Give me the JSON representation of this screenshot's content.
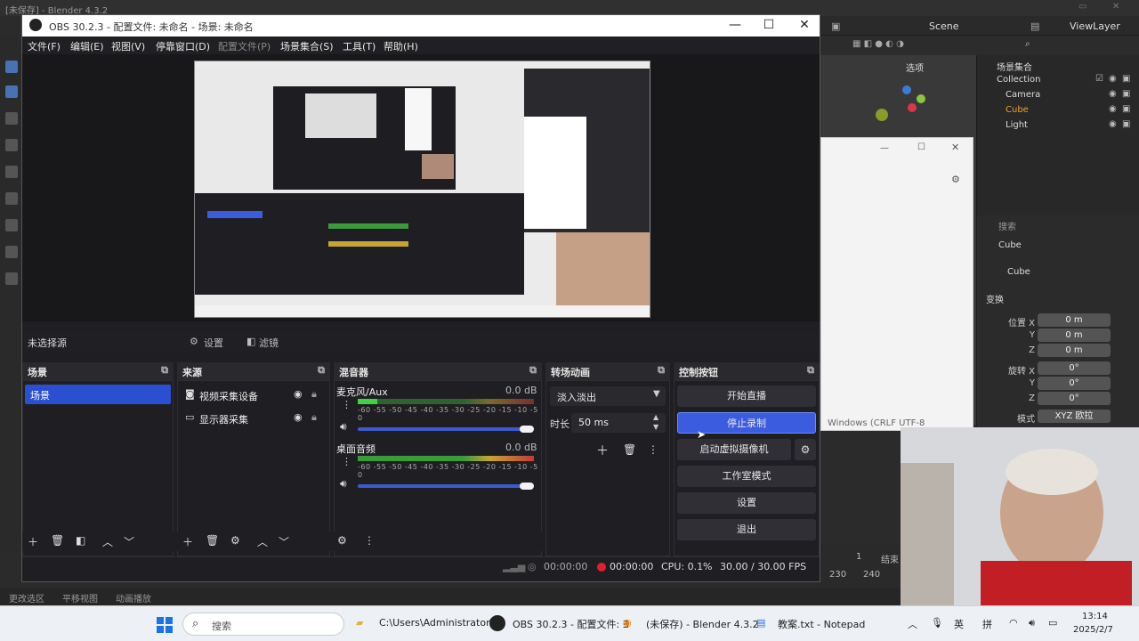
{
  "blender": {
    "title": "[未保存] - Blender 4.3.2",
    "scene": "Scene",
    "view_layer": "ViewLayer",
    "outliner": {
      "options": "选项",
      "items": [
        {
          "label": "场景集合"
        },
        {
          "label": "Collection"
        },
        {
          "label": "Camera"
        },
        {
          "label": "Cube"
        },
        {
          "label": "Light"
        }
      ]
    },
    "properties": {
      "search_placeholder": "搜索",
      "object_name": "Cube",
      "mesh_name": "Cube",
      "section": "变换",
      "location_label": "位置 X",
      "rotation_label": "旋转 X",
      "y": "Y",
      "z": "Z",
      "loc": [
        "0 m",
        "0 m",
        "0 m"
      ],
      "rot": [
        "0°",
        "0°",
        "0°"
      ],
      "mode_label": "模式",
      "mode_value": "XYZ 欧拉"
    },
    "notepad_status": "Windows (CRLF    UTF-8",
    "timeline": {
      "nums": [
        "1",
        "结束",
        "230",
        "240"
      ]
    },
    "statusbar": [
      "更改选区",
      "平移视图",
      "动画播放"
    ]
  },
  "obs": {
    "title": "OBS 30.2.3 - 配置文件: 未命名 - 场景: 未命名",
    "menu": [
      "文件(F)",
      "编辑(E)",
      "视图(V)",
      "停靠窗口(D)",
      "配置文件(P)",
      "场景集合(S)",
      "工具(T)",
      "帮助(H)"
    ],
    "source_bar": {
      "none_selected": "未选择源",
      "settings": "设置",
      "filters": "滤镜"
    },
    "docks": {
      "scenes": {
        "title": "场景",
        "items": [
          "场景"
        ]
      },
      "sources": {
        "title": "来源",
        "items": [
          "视频采集设备",
          "显示器采集"
        ]
      },
      "mixer": {
        "title": "混音器",
        "channels": [
          {
            "name": "麦克风/Aux",
            "db": "0.0 dB"
          },
          {
            "name": "桌面音频",
            "db": "0.0 dB"
          }
        ],
        "ticks": "-60 -55 -50 -45 -40 -35 -30 -25 -20 -15 -10 -5  0"
      },
      "transitions": {
        "title": "转场动画",
        "selected": "淡入淡出",
        "duration_label": "时长",
        "duration": "50 ms"
      },
      "controls": {
        "title": "控制按钮",
        "buttons": [
          "开始直播",
          "停止录制",
          "启动虚拟摄像机",
          "工作室模式",
          "设置",
          "退出"
        ]
      }
    },
    "status": {
      "live_time": "00:00:00",
      "rec_time": "00:00:00",
      "cpu": "CPU: 0.1%",
      "fps": "30.00 / 30.00 FPS"
    },
    "colors": {
      "accent": "#3c5ce0",
      "rec": "#e0202a"
    }
  },
  "taskbar": {
    "search_placeholder": "搜索",
    "items": [
      {
        "label": "C:\\Users\\Administrator\\"
      },
      {
        "label": "OBS 30.2.3 - 配置文件: ∃"
      },
      {
        "label": "(未保存) - Blender 4.3.2"
      },
      {
        "label": "教案.txt - Notepad"
      }
    ],
    "ime": "英",
    "ime2": "拼",
    "time": "13:14",
    "date": "2025/2/7"
  }
}
